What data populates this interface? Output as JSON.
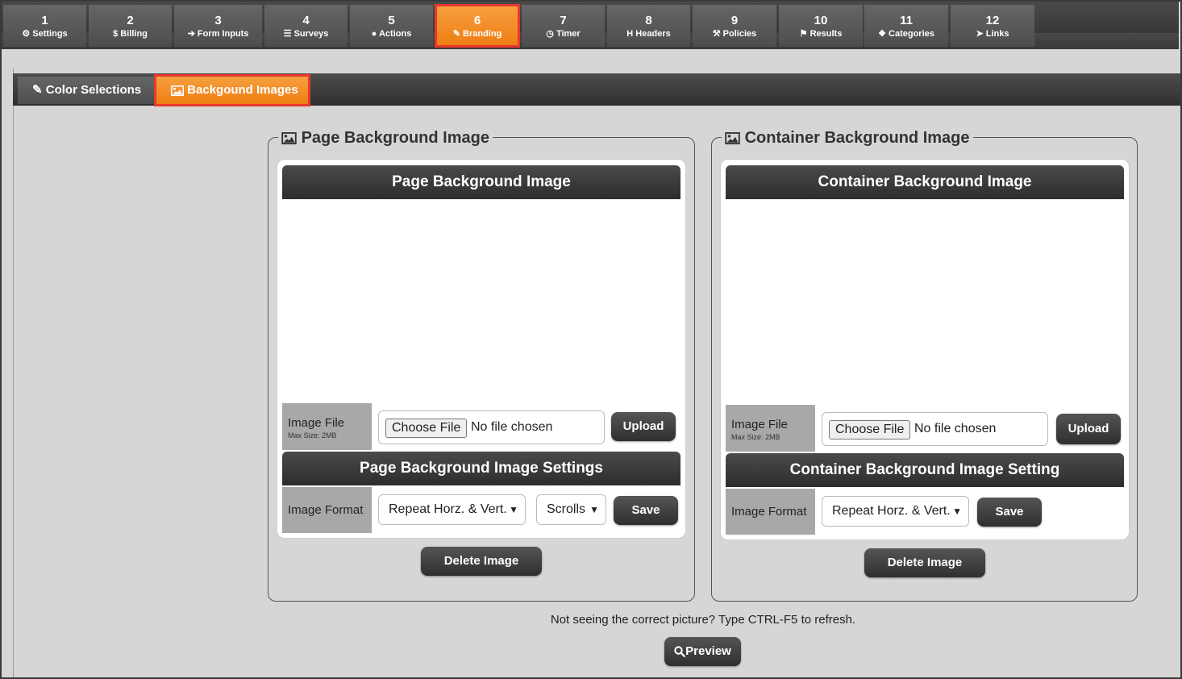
{
  "steps": [
    {
      "num": "1",
      "label": "Settings",
      "icon": "gear-icon"
    },
    {
      "num": "2",
      "label": "Billing",
      "icon": "dollar-icon"
    },
    {
      "num": "3",
      "label": "Form Inputs",
      "icon": "sign-in-icon"
    },
    {
      "num": "4",
      "label": "Surveys",
      "icon": "list-icon"
    },
    {
      "num": "5",
      "label": "Actions",
      "icon": "user-icon"
    },
    {
      "num": "6",
      "label": "Branding",
      "icon": "paintbrush-icon"
    },
    {
      "num": "7",
      "label": "Timer",
      "icon": "clock-icon"
    },
    {
      "num": "8",
      "label": "Headers",
      "icon": "header-icon"
    },
    {
      "num": "9",
      "label": "Policies",
      "icon": "gavel-icon"
    },
    {
      "num": "10",
      "label": "Results",
      "icon": "flag-icon"
    },
    {
      "num": "11",
      "label": "Categories",
      "icon": "cubes-icon"
    },
    {
      "num": "12",
      "label": "Links",
      "icon": "pointer-icon"
    }
  ],
  "active_step": "6",
  "subtabs": {
    "color_selections": "Color Selections",
    "background_images": "Backgound Images"
  },
  "page_bg": {
    "legend": "Page Background Image",
    "header": "Page Background Image",
    "image_file_label": "Image File",
    "max_size": "Max Size: 2MB",
    "choose_file": "Choose File",
    "no_file": "No file chosen",
    "upload": "Upload",
    "settings_header": "Page Background Image Settings",
    "image_format_label": "Image Format",
    "format_value": "Repeat Horz. & Vert.",
    "scroll_value": "Scrolls",
    "save": "Save",
    "delete": "Delete Image"
  },
  "container_bg": {
    "legend": "Container Background Image",
    "header": "Container Background Image",
    "image_file_label": "Image File",
    "max_size": "Max Size: 2MB",
    "choose_file": "Choose File",
    "no_file": "No file chosen",
    "upload": "Upload",
    "settings_header": "Container Background Image Setting",
    "image_format_label": "Image Format",
    "format_value": "Repeat Horz. & Vert.",
    "save": "Save",
    "delete": "Delete Image"
  },
  "refresh_note": "Not seeing the correct picture? Type CTRL-F5 to refresh.",
  "preview": "Preview",
  "colors": {
    "accent_orange": "#ee7d12",
    "highlight_red": "#e8382f",
    "dark_bar": "#2f2f2f",
    "page_bg": "#d6d6d6"
  }
}
